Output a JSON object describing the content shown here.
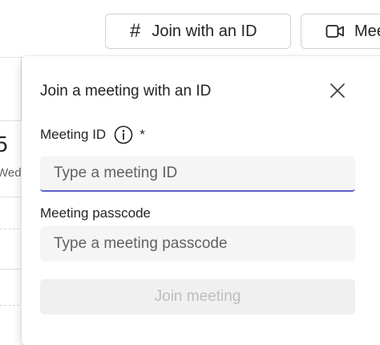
{
  "background": {
    "day_number": "5",
    "day_name": "Wednes"
  },
  "toolbar": {
    "join_id_label": "Join with an ID",
    "join_id_icon": "hash-icon",
    "meet_now_label": "Meet now",
    "meet_now_icon": "video-camera-icon"
  },
  "join_dialog": {
    "title": "Join a meeting with an ID",
    "close_icon": "close-icon",
    "meeting_id_label": "Meeting ID",
    "meeting_id_info_icon": "info-icon",
    "meeting_id_required_marker": "*",
    "meeting_id_placeholder": "Type a meeting ID",
    "meeting_id_value": "",
    "passcode_label": "Meeting passcode",
    "passcode_placeholder": "Type a meeting passcode",
    "passcode_value": "",
    "join_button_label": "Join meeting",
    "join_button_enabled": false
  },
  "colors": {
    "focus_underline": "#5b5fc7",
    "input_background": "#f5f5f5",
    "disabled_button_bg": "#f0f0f0",
    "disabled_button_text": "#bdbdbd"
  }
}
